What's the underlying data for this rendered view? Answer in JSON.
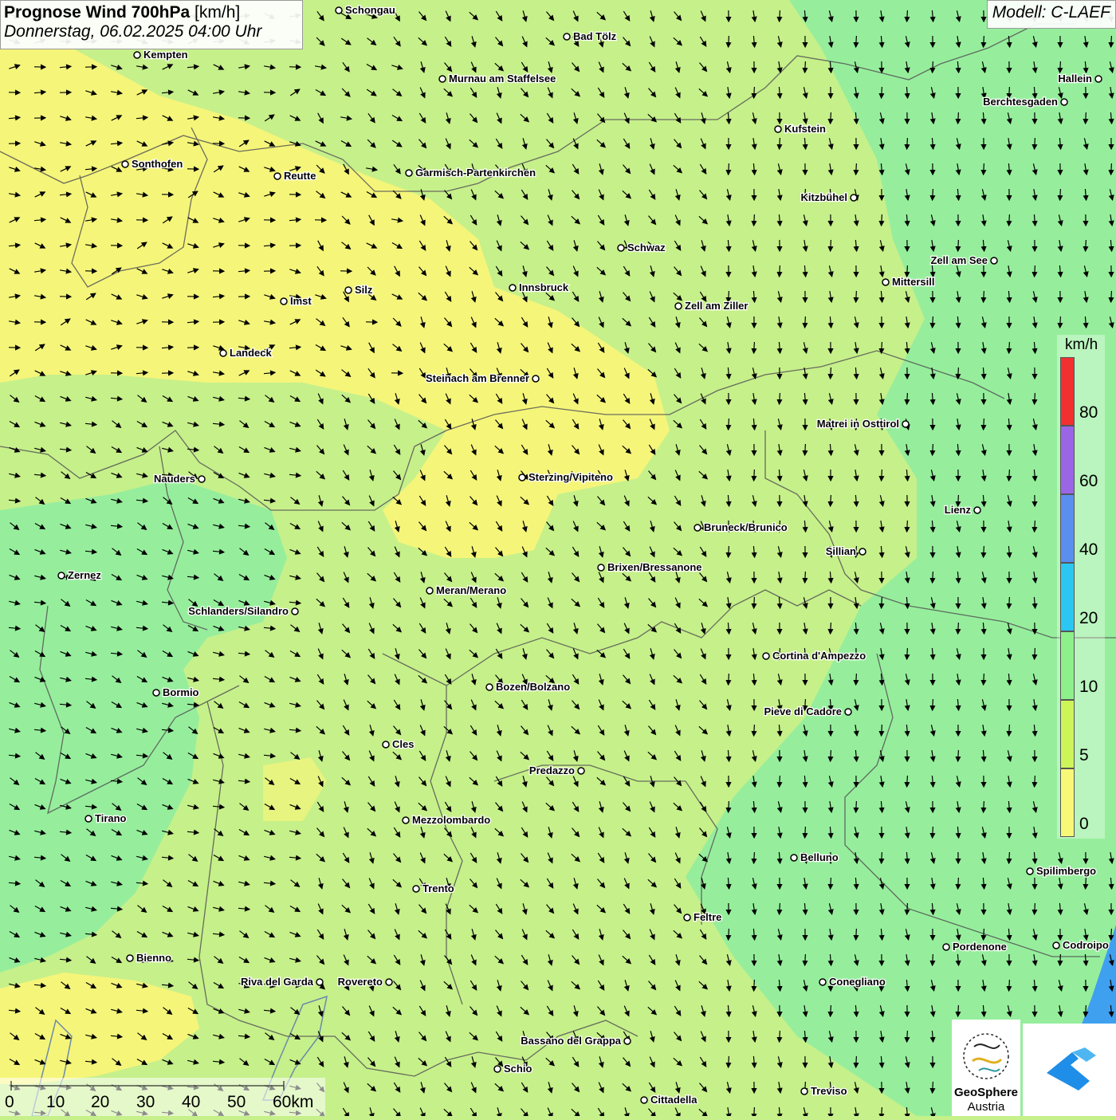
{
  "title": {
    "main": "Prognose Wind 700hPa",
    "unit": "[km/h]",
    "datetime": "Donnerstag, 06.02.2025 04:00 Uhr"
  },
  "model": "Modell: C-LAEF",
  "legend": {
    "unit": "km/h",
    "labels": [
      "80",
      "60",
      "40",
      "20",
      "10",
      "5",
      "0"
    ],
    "colors": [
      "#f23030",
      "#9a66e6",
      "#5a8ff0",
      "#2cc6f2",
      "#8ef08a",
      "#cdf55a",
      "#f8f878"
    ]
  },
  "scale": {
    "labels": [
      "0",
      "10",
      "20",
      "30",
      "40",
      "50",
      "60km"
    ]
  },
  "logo": {
    "line1": "GeoSphere",
    "line2": "Austria"
  },
  "cities": [
    "Schongau",
    "Bad Tölz",
    "Kempten",
    "Murnau am Staffelsee",
    "Hallein",
    "Berchtesgaden",
    "Kufstein",
    "Sonthofen",
    "Reutte",
    "Garmisch-Partenkirchen",
    "Kitzbühel",
    "Schwaz",
    "Zell am See",
    "Mittersill",
    "Innsbruck",
    "Silz",
    "Imst",
    "Zell am Ziller",
    "Landeck",
    "Steinach am Brenner",
    "Matrei in Osttirol",
    "Nauders",
    "Sterzing/Vipiteno",
    "Lienz",
    "Bruneck/Brunico",
    "Sillian",
    "Zernez",
    "Brixen/Bressanone",
    "Meran/Merano",
    "Schlanders/Silandro",
    "Cortina d'Ampezzo",
    "Bozen/Bolzano",
    "Bormio",
    "Pieve di Cadore",
    "Cles",
    "Predazzo",
    "Tirano",
    "Mezzolombardo",
    "Belluno",
    "Spilimbergo",
    "Trento",
    "Feltre",
    "Pordenone",
    "Codroipo",
    "Bienno",
    "Riva del Garda",
    "Rovereto",
    "Conegliano",
    "Bassano del Grappa",
    "Schio",
    "Treviso",
    "Cittadella"
  ],
  "colors": {
    "wind_0_5": "#f5f57a",
    "wind_5_10": "#c6f08a",
    "wind_10_20": "#96ee9c",
    "water": "#3fa0f0"
  }
}
